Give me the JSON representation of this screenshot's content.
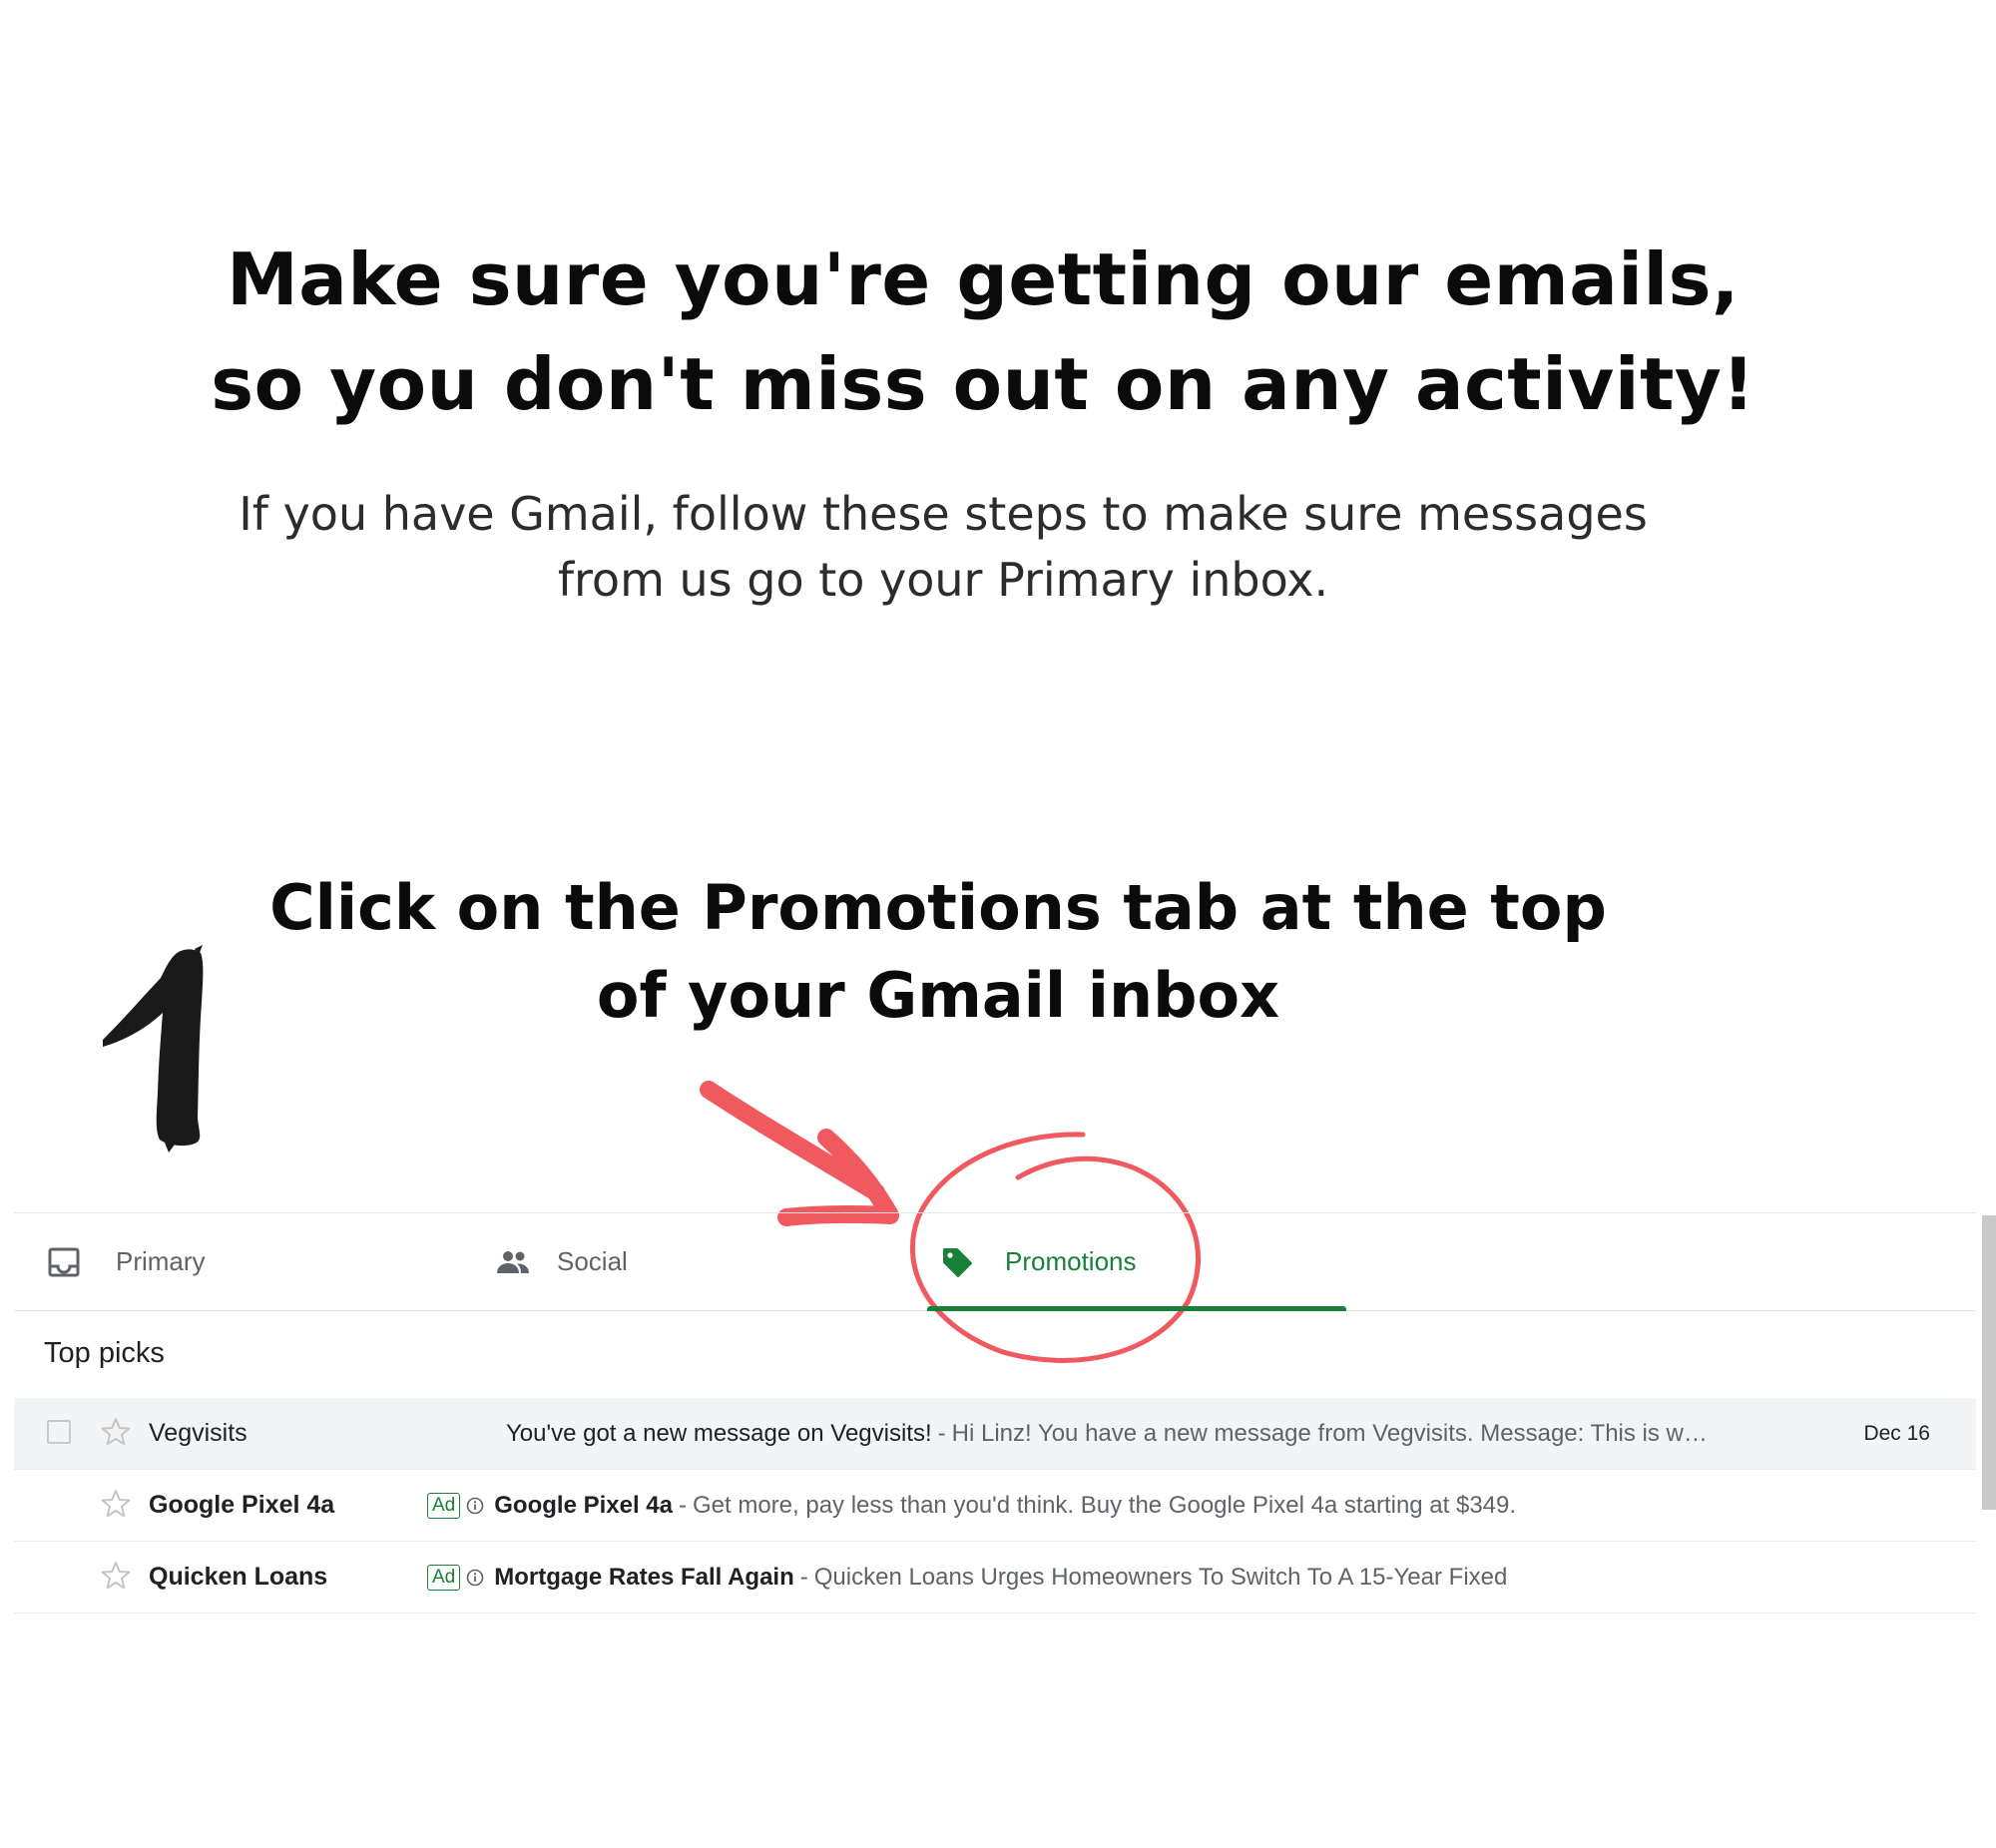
{
  "headline": {
    "line1": "Make sure you're getting our emails,",
    "line2": "so you don't miss out on any activity!"
  },
  "subtext": {
    "line1": "If you have Gmail, follow these steps to make sure messages",
    "line2": "from us go to your Primary inbox."
  },
  "step": {
    "title_line1": "Click on the Promotions tab at the top",
    "title_line2": "of your Gmail inbox"
  },
  "annotation_color": "#f05a5e",
  "gmail": {
    "tabs": [
      {
        "label": "Primary",
        "icon": "inbox-icon",
        "active": false
      },
      {
        "label": "Social",
        "icon": "people-icon",
        "active": false
      },
      {
        "label": "Promotions",
        "icon": "tag-icon",
        "active": true
      }
    ],
    "accent_color": "#188038",
    "section_title": "Top picks",
    "rows": [
      {
        "sender": "Vegvisits",
        "subject": "You've got a new message on Vegvisits!",
        "snippet": "Hi Linz! You have a new message from Vegvisits. Message: This is w…",
        "date": "Dec 16",
        "ad": false
      },
      {
        "sender": "Google Pixel 4a",
        "ad_label": "Ad",
        "subject": "Google Pixel 4a",
        "snippet": "Get more, pay less than you'd think. Buy the Google Pixel 4a starting at $349.",
        "ad": true
      },
      {
        "sender": "Quicken Loans",
        "ad_label": "Ad",
        "subject": "Mortgage Rates Fall Again",
        "snippet": "Quicken Loans Urges Homeowners To Switch To A 15-Year Fixed",
        "ad": true
      }
    ],
    "separator": "-"
  }
}
